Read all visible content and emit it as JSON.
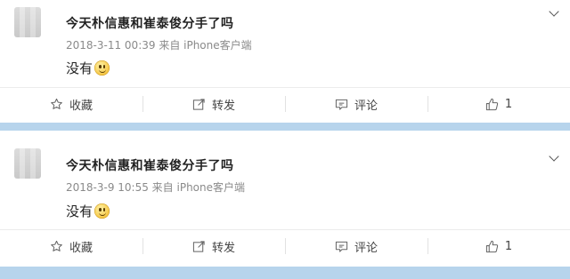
{
  "posts": [
    {
      "title": "今天朴信惠和崔泰俊分手了吗",
      "meta": "2018-3-11 00:39 来自 iPhone客户端",
      "content": "没有",
      "actions": {
        "favorite": "收藏",
        "repost": "转发",
        "comment": "评论",
        "like_count": "1"
      }
    },
    {
      "title": "今天朴信惠和崔泰俊分手了吗",
      "meta": "2018-3-9 10:55 来自 iPhone客户端",
      "content": "没有",
      "actions": {
        "favorite": "收藏",
        "repost": "转发",
        "comment": "评论",
        "like_count": "1"
      }
    }
  ],
  "colors": {
    "separator": "#b7d4ec",
    "meta_text": "#8a8a8a",
    "emoji": "#f5c542"
  },
  "icons": [
    "star-icon",
    "repost-icon",
    "comment-icon",
    "thumbs-up-icon",
    "chevron-down-icon",
    "smile-emoji-icon"
  ]
}
